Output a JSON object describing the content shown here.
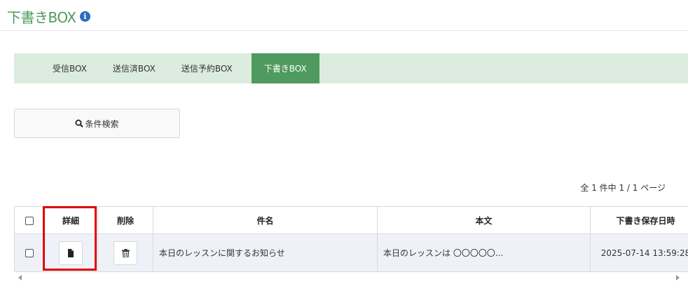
{
  "header": {
    "title": "下書きBOX",
    "info_icon": "i"
  },
  "tabs": [
    {
      "label": "受信BOX",
      "active": false
    },
    {
      "label": "送信済BOX",
      "active": false
    },
    {
      "label": "送信予約BOX",
      "active": false
    },
    {
      "label": "下書きBOX",
      "active": true
    }
  ],
  "search": {
    "label": "条件検索",
    "icon": "search-icon"
  },
  "pager": {
    "text": "全 1 件中 1 / 1 ページ"
  },
  "table": {
    "columns": [
      "",
      "詳細",
      "削除",
      "件名",
      "本文",
      "下書き保存日時"
    ],
    "rows": [
      {
        "subject": "本日のレッスンに関するお知らせ",
        "body": "本日のレッスンは 〇〇〇〇〇...",
        "saved_at": "2025-07-14 13:59:28",
        "detail_icon": "document-icon",
        "delete_icon": "trash-icon"
      }
    ]
  },
  "colors": {
    "accent_green": "#4e9a5f",
    "tab_bar_bg": "#dcecdf",
    "highlight_red": "#e00000",
    "row_bg": "#eef2f8"
  }
}
